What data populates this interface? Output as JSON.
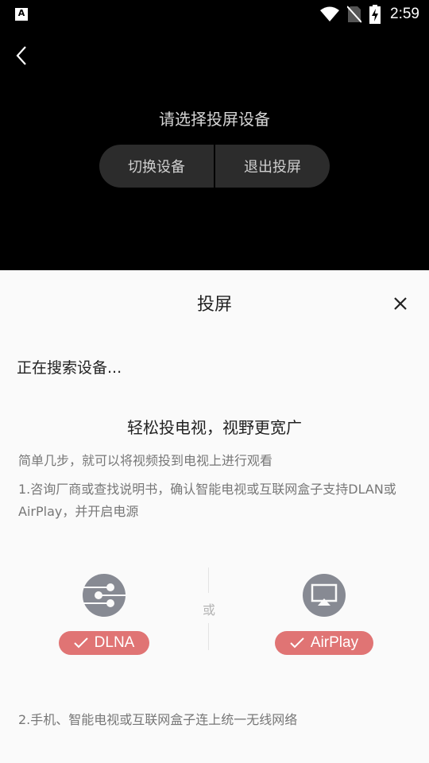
{
  "status_bar": {
    "notification_icon": "A",
    "time": "2:59",
    "icons": [
      "wifi-icon",
      "no-sim-icon",
      "battery-charging-icon"
    ]
  },
  "player": {
    "back_icon": "chevron-left-icon",
    "title": "请选择投屏设备",
    "switch_device_label": "切换设备",
    "exit_cast_label": "退出投屏"
  },
  "sheet": {
    "title": "投屏",
    "close_icon": "close-icon",
    "searching_text": "正在搜索设备...",
    "headline": "轻松投电视，视野更宽广",
    "subline": "简单几步，就可以将视频投到电视上进行观看",
    "step1": "1.咨询厂商或查找说明书，确认智能电视或互联网盒子支持DLAN或AirPlay，并开启电源",
    "protocols": [
      {
        "name": "DLNA",
        "icon": "dlna-share-icon",
        "checked": true
      },
      {
        "name": "AirPlay",
        "icon": "airplay-icon",
        "checked": true
      }
    ],
    "or_text": "或",
    "step2": "2.手机、智能电视或互联网盒子连上统一无线网络"
  },
  "colors": {
    "badge": "#e07474",
    "protocol_icon_bg": "#878a93",
    "button_bg": "#2c2c2c",
    "sheet_bg": "#fafafa"
  }
}
